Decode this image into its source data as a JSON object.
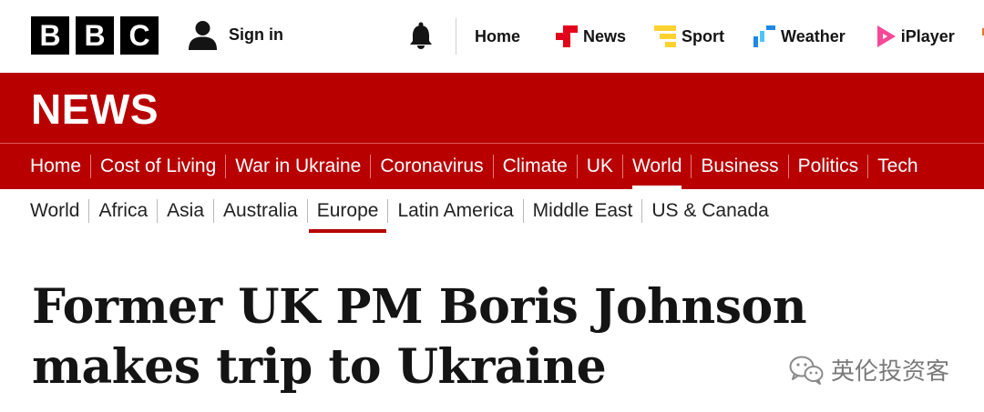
{
  "brand": {
    "letters": [
      "B",
      "B",
      "C"
    ]
  },
  "account": {
    "signin_label": "Sign in"
  },
  "top_nav": {
    "items": [
      {
        "label": "Home"
      },
      {
        "label": "News"
      },
      {
        "label": "Sport"
      },
      {
        "label": "Weather"
      },
      {
        "label": "iPlayer"
      }
    ]
  },
  "section": {
    "title": "NEWS"
  },
  "main_nav": {
    "active": "World",
    "items": [
      "Home",
      "Cost of Living",
      "War in Ukraine",
      "Coronavirus",
      "Climate",
      "UK",
      "World",
      "Business",
      "Politics",
      "Tech"
    ]
  },
  "sub_nav": {
    "active": "Europe",
    "items": [
      "World",
      "Africa",
      "Asia",
      "Australia",
      "Europe",
      "Latin America",
      "Middle East",
      "US & Canada"
    ]
  },
  "article": {
    "headline": "Former UK PM Boris Johnson makes trip to Ukraine"
  },
  "watermark": {
    "text": "英伦投资客"
  },
  "colors": {
    "brand_red": "#b80000",
    "news_icon": "#e3001b",
    "sport_icon": "#ffd230",
    "weather_icon": "#1e88e5",
    "iplayer_icon": "#f54997"
  }
}
